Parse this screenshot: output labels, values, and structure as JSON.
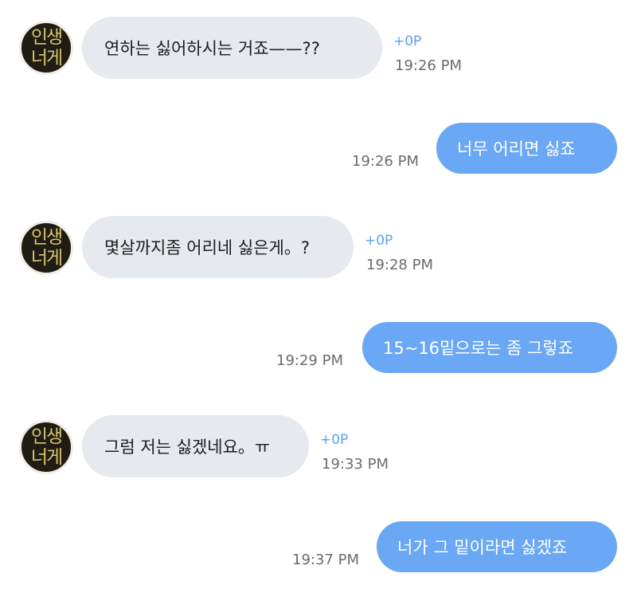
{
  "avatar": {
    "line1": "인생",
    "line2": "너게"
  },
  "messages": [
    {
      "dir": "in",
      "text": "연하는 싫어하시는 거죠——??",
      "points": "+0P",
      "time": "19:26 PM"
    },
    {
      "dir": "out",
      "text": "너무 어리면 싫죠",
      "time": "19:26 PM"
    },
    {
      "dir": "in",
      "text": "몇살까지좀 어리네 싫은게。?",
      "points": "+0P",
      "time": "19:28 PM"
    },
    {
      "dir": "out",
      "text": "15~16밑으로는 좀 그렇죠",
      "time": "19:29 PM"
    },
    {
      "dir": "in",
      "text": "그럼 저는 싫겠네요。ㅠ",
      "points": "+0P",
      "time": "19:33 PM"
    },
    {
      "dir": "out",
      "text": "너가 그 밑이라면 싫겠죠",
      "time": "19:37 PM"
    }
  ]
}
